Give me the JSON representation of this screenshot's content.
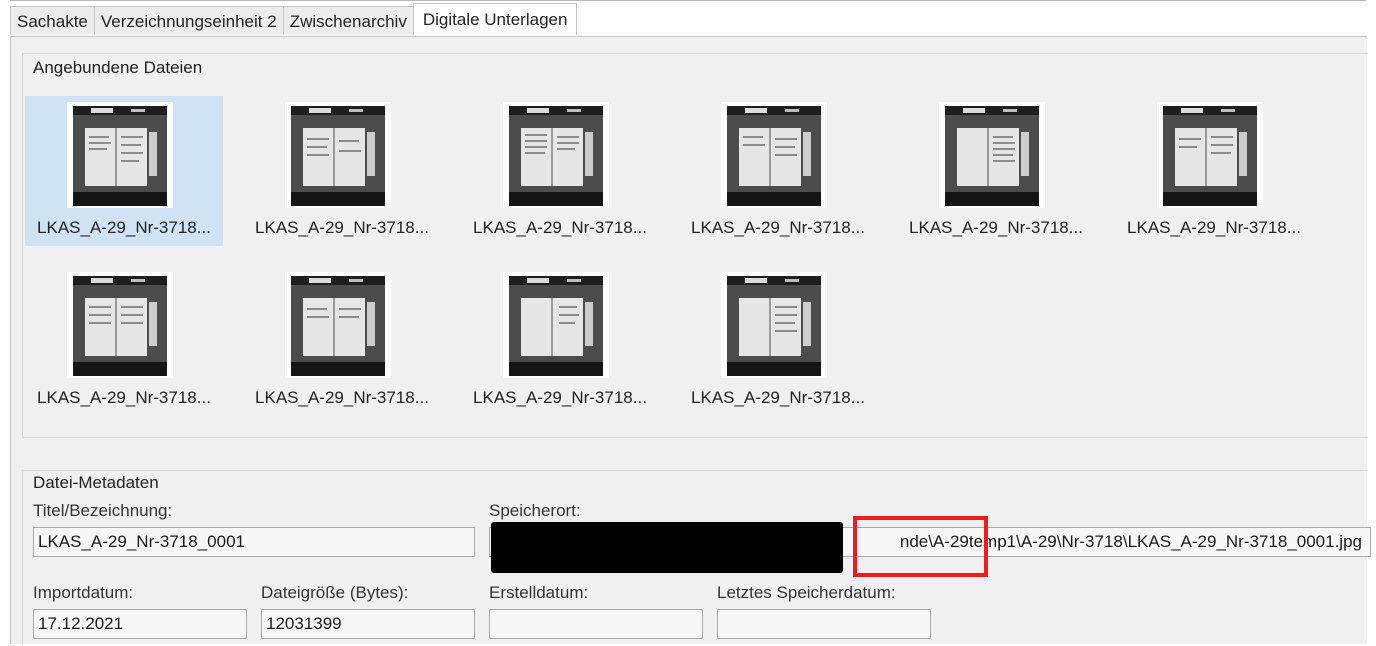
{
  "tabs": [
    {
      "label": "Sachakte"
    },
    {
      "label": "Verzeichnungseinheit 2"
    },
    {
      "label": "Zwischenarchiv"
    },
    {
      "label": "Digitale Unterlagen"
    }
  ],
  "files_group": {
    "title": "Angebundene Dateien",
    "items": [
      {
        "caption": "LKAS_A-29_Nr-3718..."
      },
      {
        "caption": "LKAS_A-29_Nr-3718..."
      },
      {
        "caption": "LKAS_A-29_Nr-3718..."
      },
      {
        "caption": "LKAS_A-29_Nr-3718..."
      },
      {
        "caption": "LKAS_A-29_Nr-3718..."
      },
      {
        "caption": "LKAS_A-29_Nr-3718..."
      },
      {
        "caption": "LKAS_A-29_Nr-3718..."
      },
      {
        "caption": "LKAS_A-29_Nr-3718..."
      },
      {
        "caption": "LKAS_A-29_Nr-3718..."
      },
      {
        "caption": "LKAS_A-29_Nr-3718..."
      }
    ]
  },
  "metadata": {
    "title": "Datei-Metadaten",
    "titel_label": "Titel/Bezeichnung:",
    "titel_value": "LKAS_A-29_Nr-3718_0001",
    "speicherort_label": "Speicherort:",
    "speicherort_value": "nde\\A-29temp1\\A-29\\Nr-3718\\LKAS_A-29_Nr-3718_0001.jpg",
    "importdatum_label": "Importdatum:",
    "importdatum_value": "17.12.2021",
    "dateigroesse_label": "Dateigröße (Bytes):",
    "dateigroesse_value": "12031399",
    "erstelldatum_label": "Erstelldatum:",
    "erstelldatum_value": "",
    "speicherdatum_label": "Letztes Speicherdatum:",
    "speicherdatum_value": ""
  },
  "colors": {
    "selection": "#cfe3f5",
    "highlight_box": "#ee1c1c",
    "redaction": "#000000"
  }
}
